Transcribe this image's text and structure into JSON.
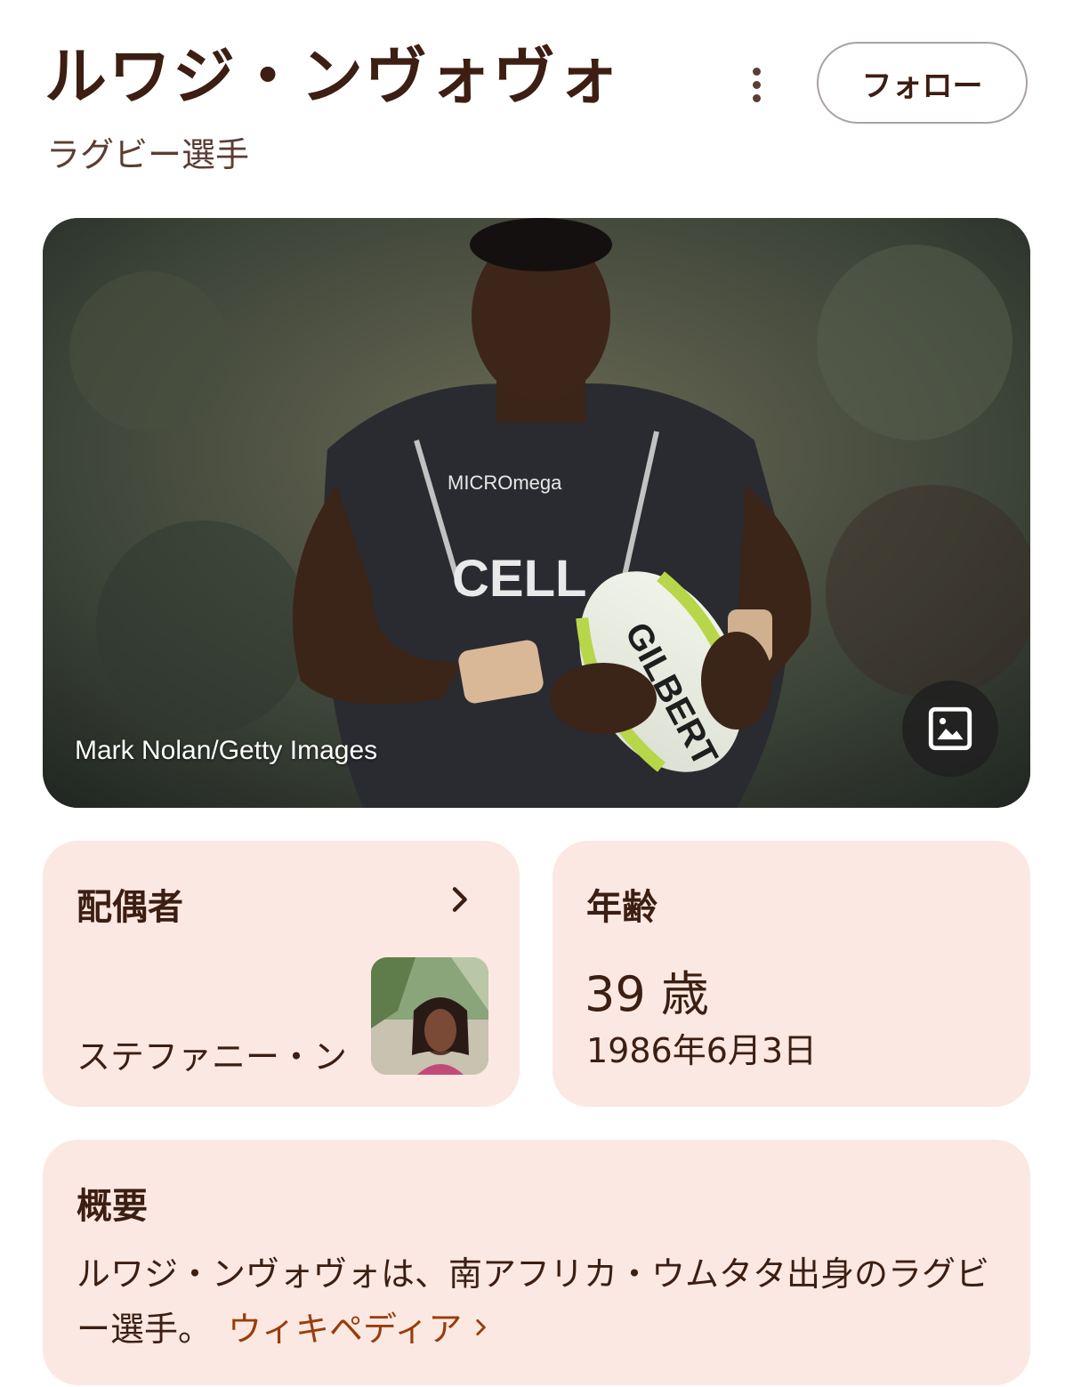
{
  "header": {
    "title": "ルワジ・ンヴォヴォ",
    "subtitle": "ラグビー選手",
    "more_icon": "more-vertical-icon",
    "follow_label": "フォロー"
  },
  "hero_image": {
    "credit": "Mark Nolan/Getty Images",
    "image_icon": "image-icon"
  },
  "spouse_card": {
    "title": "配偶者",
    "chevron_icon": "chevron-right-icon",
    "name": "ステファニー・ン"
  },
  "age_card": {
    "title": "年齢",
    "age": "39 歳",
    "birth_date": "1986年6月3日"
  },
  "about_card": {
    "title": "概要",
    "text": "ルワジ・ンヴォヴォは、南アフリカ・ウムタタ出身のラグビー選手。",
    "link_label": "ウィキペディア"
  },
  "colors": {
    "text": "#3c1e12",
    "card_bg": "#fbe8e2",
    "link": "#9a3c0a"
  }
}
